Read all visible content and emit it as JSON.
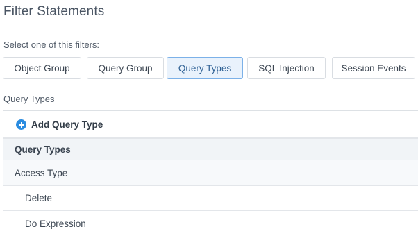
{
  "page": {
    "title": "Filter Statements",
    "filters_prompt": "Select one of this filters:"
  },
  "filters": [
    {
      "label": "Object Group",
      "active": false
    },
    {
      "label": "Query Group",
      "active": false
    },
    {
      "label": "Query Types",
      "active": true
    },
    {
      "label": "SQL Injection",
      "active": false
    },
    {
      "label": "Session Events",
      "active": false
    }
  ],
  "section": {
    "label": "Query Types",
    "add_button_label": "Add Query Type",
    "add_icon": "plus-circle-icon",
    "table_header": "Query Types",
    "group": {
      "label": "Access Type",
      "items": [
        "Delete",
        "Do Expression"
      ]
    }
  },
  "colors": {
    "accent": "#2b8ce0",
    "active_filter_bg": "#e9f2fc",
    "active_filter_border": "#7cb1e8",
    "header_bg": "#f1f4f7"
  }
}
